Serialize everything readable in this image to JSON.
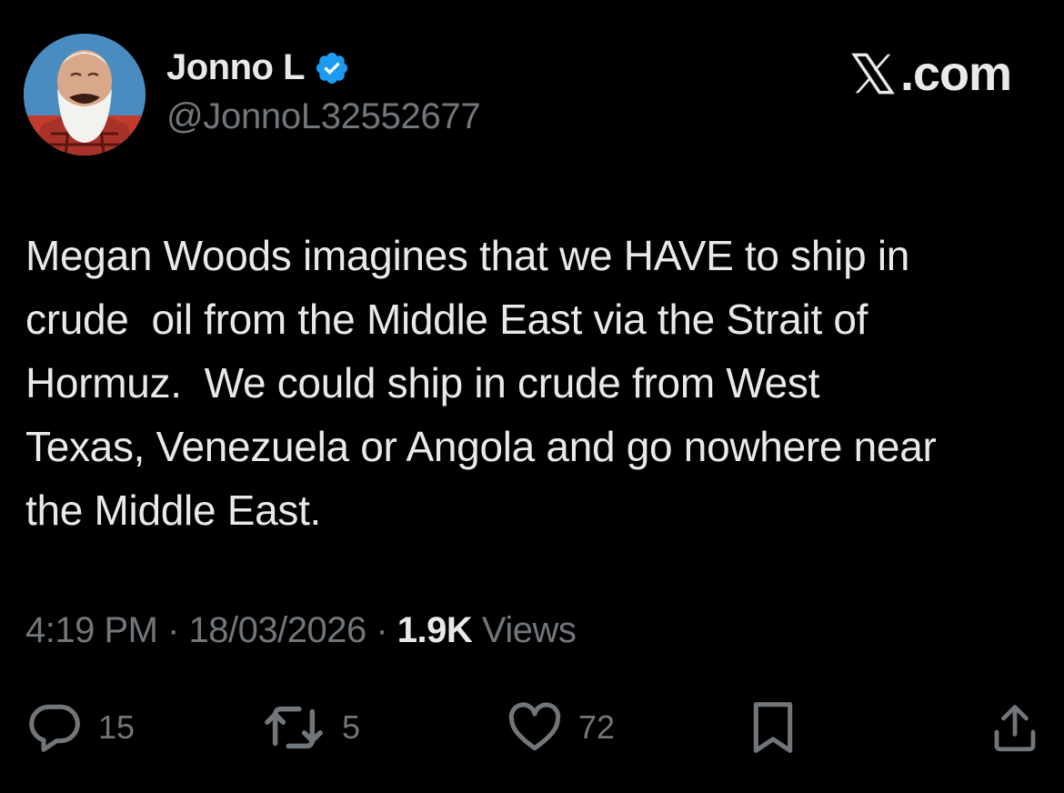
{
  "author": {
    "display_name": "Jonno L",
    "handle": "@JonnoL32552677",
    "verified": true
  },
  "brand": {
    "label": ".com",
    "icon": "x-logo-icon"
  },
  "tweet": {
    "text": "Megan Woods imagines that we HAVE to ship in\ncrude  oil from the Middle East via the Strait of\nHormuz.  We could ship in crude from West\nTexas, Venezuela or Angola and go nowhere near\nthe Middle East."
  },
  "meta": {
    "time": "4:19 PM",
    "date": "18/03/2026",
    "separator": " · ",
    "views_count": "1.9K",
    "views_label": " Views"
  },
  "actions": {
    "replies": "15",
    "reposts": "5",
    "likes": "72"
  },
  "colors": {
    "background": "#000000",
    "text": "#e7e9ea",
    "muted": "#71767b",
    "verified": "#1d9bf0"
  }
}
